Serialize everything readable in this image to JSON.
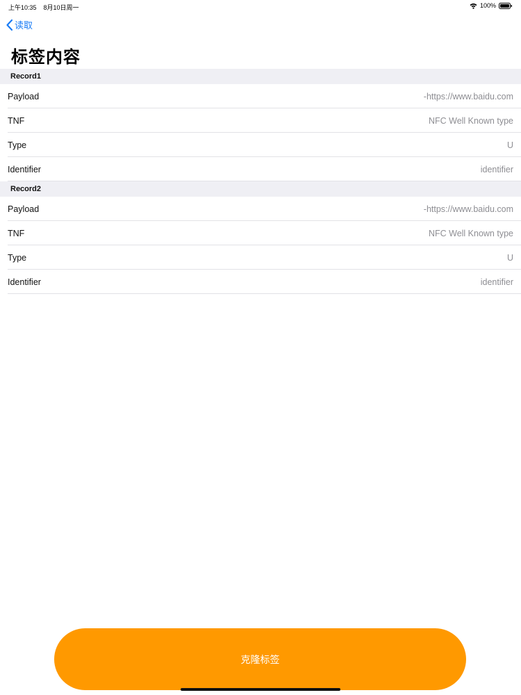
{
  "status_bar": {
    "time": "上午10:35",
    "date": "8月10日周一",
    "battery": "100%"
  },
  "nav": {
    "back_label": "读取",
    "back_icon": "chevron-left-icon"
  },
  "page_title": "标签内容",
  "sections": [
    {
      "header": "Record1",
      "rows": [
        {
          "key": "Payload",
          "value": "-https://www.baidu.com"
        },
        {
          "key": "TNF",
          "value": "NFC Well Known type"
        },
        {
          "key": "Type",
          "value": "U"
        },
        {
          "key": "Identifier",
          "value": "identifier"
        }
      ]
    },
    {
      "header": "Record2",
      "rows": [
        {
          "key": "Payload",
          "value": "-https://www.baidu.com"
        },
        {
          "key": "TNF",
          "value": "NFC Well Known type"
        },
        {
          "key": "Type",
          "value": "U"
        },
        {
          "key": "Identifier",
          "value": "identifier"
        }
      ]
    }
  ],
  "action_button": {
    "label": "克隆标签",
    "color": "#ff9900"
  },
  "colors": {
    "accent": "#1a7cf5",
    "section_bg": "#efeff4",
    "secondary_text": "#8e8e93"
  }
}
